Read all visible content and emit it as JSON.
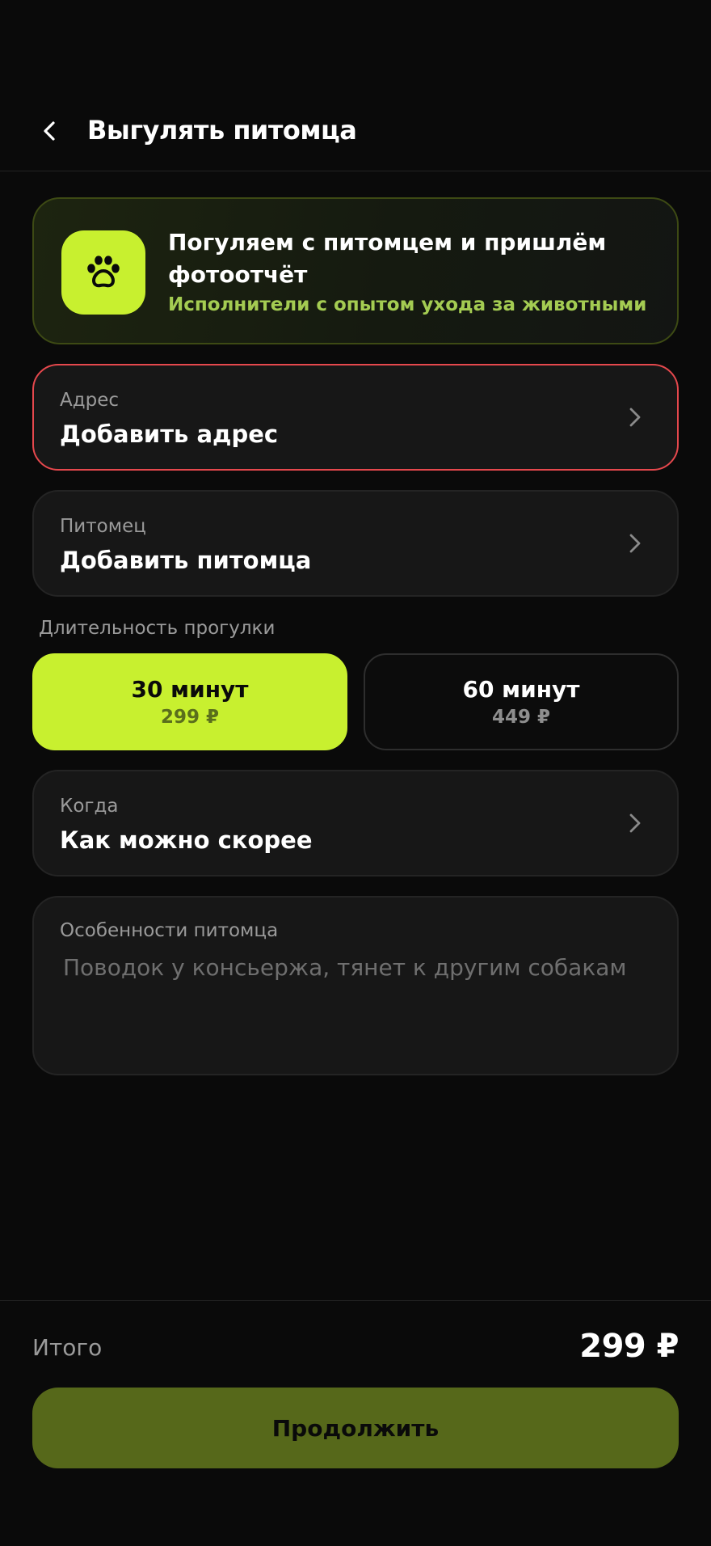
{
  "header": {
    "title": "Выгулять питомца",
    "back_icon": "chevron-left-icon"
  },
  "promo": {
    "icon": "paw-icon",
    "title": "Погуляем с питомцем и пришлём фотоотчёт",
    "subtitle": "Исполнители с опытом ухода за животными"
  },
  "address": {
    "label": "Адрес",
    "value": "Добавить адрес",
    "state": "error"
  },
  "pet": {
    "label": "Питомец",
    "value": "Добавить питомца"
  },
  "duration": {
    "label": "Длительность прогулки",
    "options": [
      {
        "title": "30 минут",
        "price": "299 ₽",
        "selected": true
      },
      {
        "title": "60 минут",
        "price": "449 ₽",
        "selected": false
      }
    ]
  },
  "when": {
    "label": "Когда",
    "value": "Как можно скорее"
  },
  "notes": {
    "label": "Особенности питомца",
    "placeholder": "Поводок у консьержа, тянет к другим собакам",
    "value": ""
  },
  "footer": {
    "total_label": "Итого",
    "total_value": "299 ₽",
    "continue_label": "Продолжить"
  },
  "colors": {
    "accent": "#c8f02f",
    "button": "#56681a",
    "error": "#e5484d",
    "background": "#0a0a0a",
    "card": "#171717",
    "promo_subtitle": "#a4cc52"
  }
}
